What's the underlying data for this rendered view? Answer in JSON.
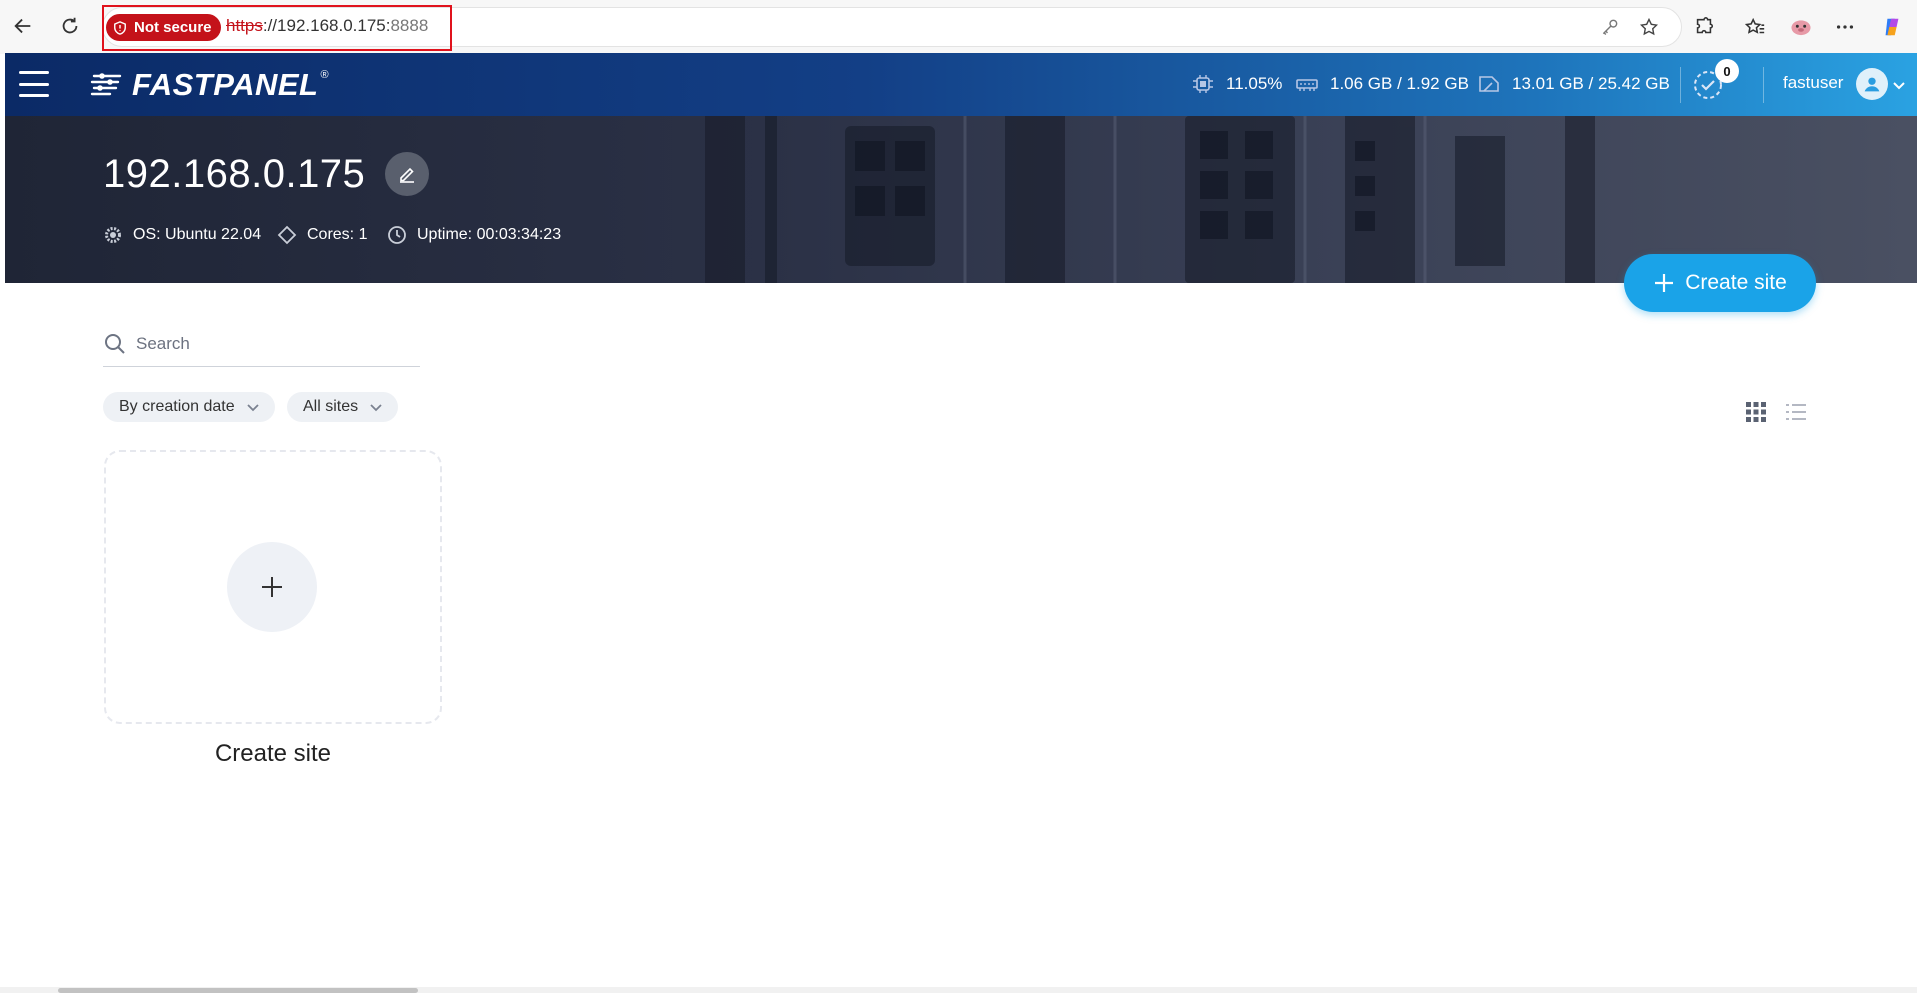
{
  "browser": {
    "security_badge": "Not secure",
    "url_protocol": "https",
    "url_host": "://192.168.0.175:",
    "url_port": "8888",
    "icons": [
      "back-icon",
      "reload-icon",
      "key-icon",
      "star-icon",
      "extensions-icon",
      "favorites-icon",
      "profile-icon",
      "more-icon",
      "copilot-icon"
    ]
  },
  "header": {
    "logo_text": "FASTPANEL",
    "logo_mark": "®",
    "cpu": "11.05%",
    "ram": "1.06 GB / 1.92 GB",
    "disk": "13.01 GB / 25.42 GB",
    "notifications_count": "0",
    "username": "fastuser"
  },
  "hero": {
    "server_title": "192.168.0.175",
    "os": "OS: Ubuntu 22.04",
    "cores": "Cores: 1",
    "uptime": "Uptime: 00:03:34:23"
  },
  "actions": {
    "create_site_label": "Create site"
  },
  "filters": {
    "search_placeholder": "Search",
    "sort_label": "By creation date",
    "type_label": "All sites",
    "view_modes": [
      "grid",
      "list"
    ],
    "active_view": "grid"
  },
  "sites": {
    "create_card_label": "Create site"
  },
  "colors": {
    "accent": "#1aa3e8",
    "header_dark": "#0b2a66",
    "header_light": "#2aa2e2",
    "insecure": "#c4121a"
  }
}
